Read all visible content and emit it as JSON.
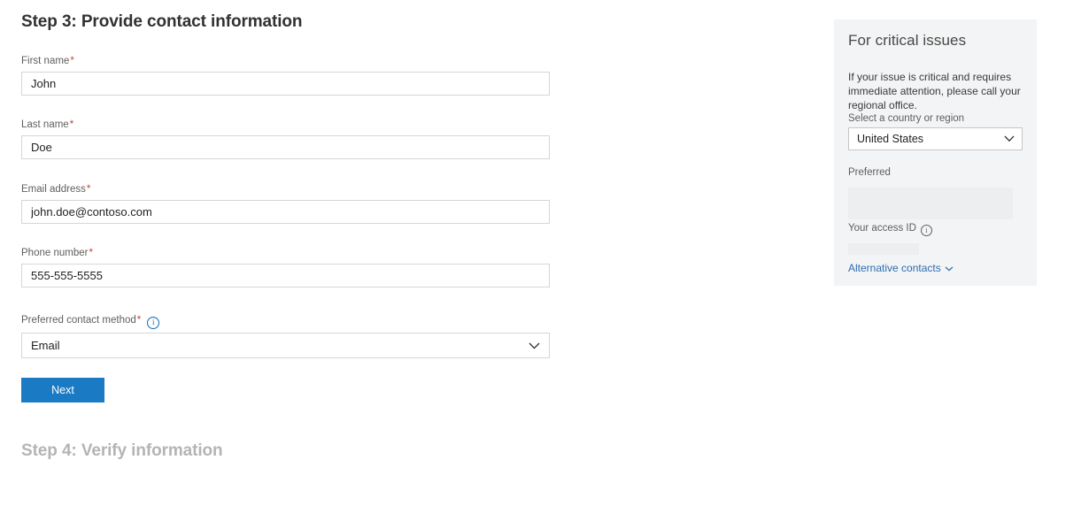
{
  "main": {
    "step_title": "Step 3: Provide contact information",
    "next_button": "Next",
    "step4_title": "Step 4: Verify information",
    "fields": [
      {
        "label": "First name",
        "required": "*",
        "value": "John",
        "type": "text"
      },
      {
        "label": "Last name",
        "required": "*",
        "value": "Doe",
        "type": "text"
      },
      {
        "label": "Email address",
        "required": "*",
        "value": "john.doe@contoso.com",
        "type": "text"
      },
      {
        "label": "Phone number",
        "required": "*",
        "value": "555-555-5555",
        "type": "text"
      },
      {
        "label": "Preferred contact method",
        "required": "*",
        "value": "Email",
        "type": "select",
        "info": "i"
      }
    ]
  },
  "side_panel": {
    "title": "For critical issues",
    "description": "If your issue is critical and requires immediate attention, please call your regional office.",
    "country_label": "Select a country or region",
    "country_value": "United States",
    "preferred_label": "Preferred",
    "access_id_label": "Your access ID",
    "access_id_info": "i",
    "alternative_contacts": "Alternative contacts"
  },
  "colors": {
    "accent": "#1a7ac4",
    "link": "#2b6cb0",
    "required": "#c4443b",
    "panel_bg": "#f3f4f6",
    "skeleton": "#eceef0",
    "title": "#323130",
    "muted_title": "#b6b4b2"
  }
}
